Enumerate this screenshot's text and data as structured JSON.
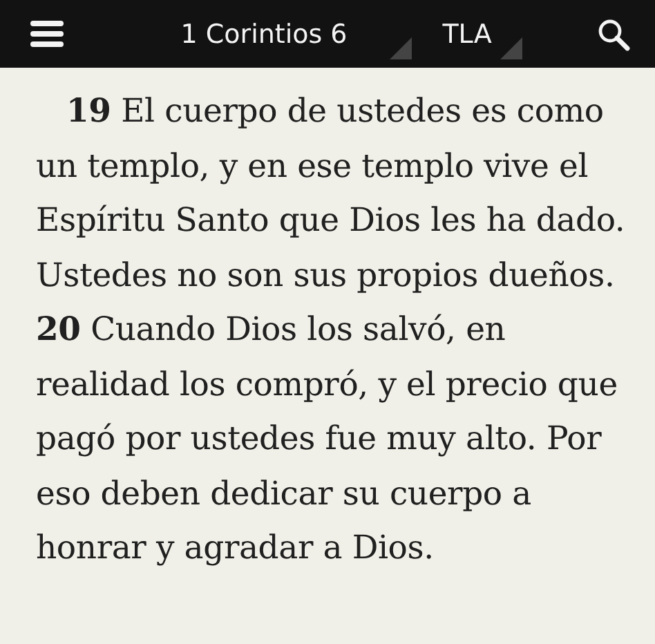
{
  "toolbar": {
    "reference": "1 Corintios 6",
    "version": "TLA"
  },
  "passage": {
    "text": "**19** El cuerpo de ustedes es como un templo, y en ese templo vive el Espíritu Santo que Dios les ha dado. Ustedes no son sus propios dueños. **20** Cuando Dios los salvó, en realidad los compró, y el precio que pagó por ustedes fue muy alto. Por eso deben dedicar su cuerpo a honrar y agradar a Dios."
  }
}
